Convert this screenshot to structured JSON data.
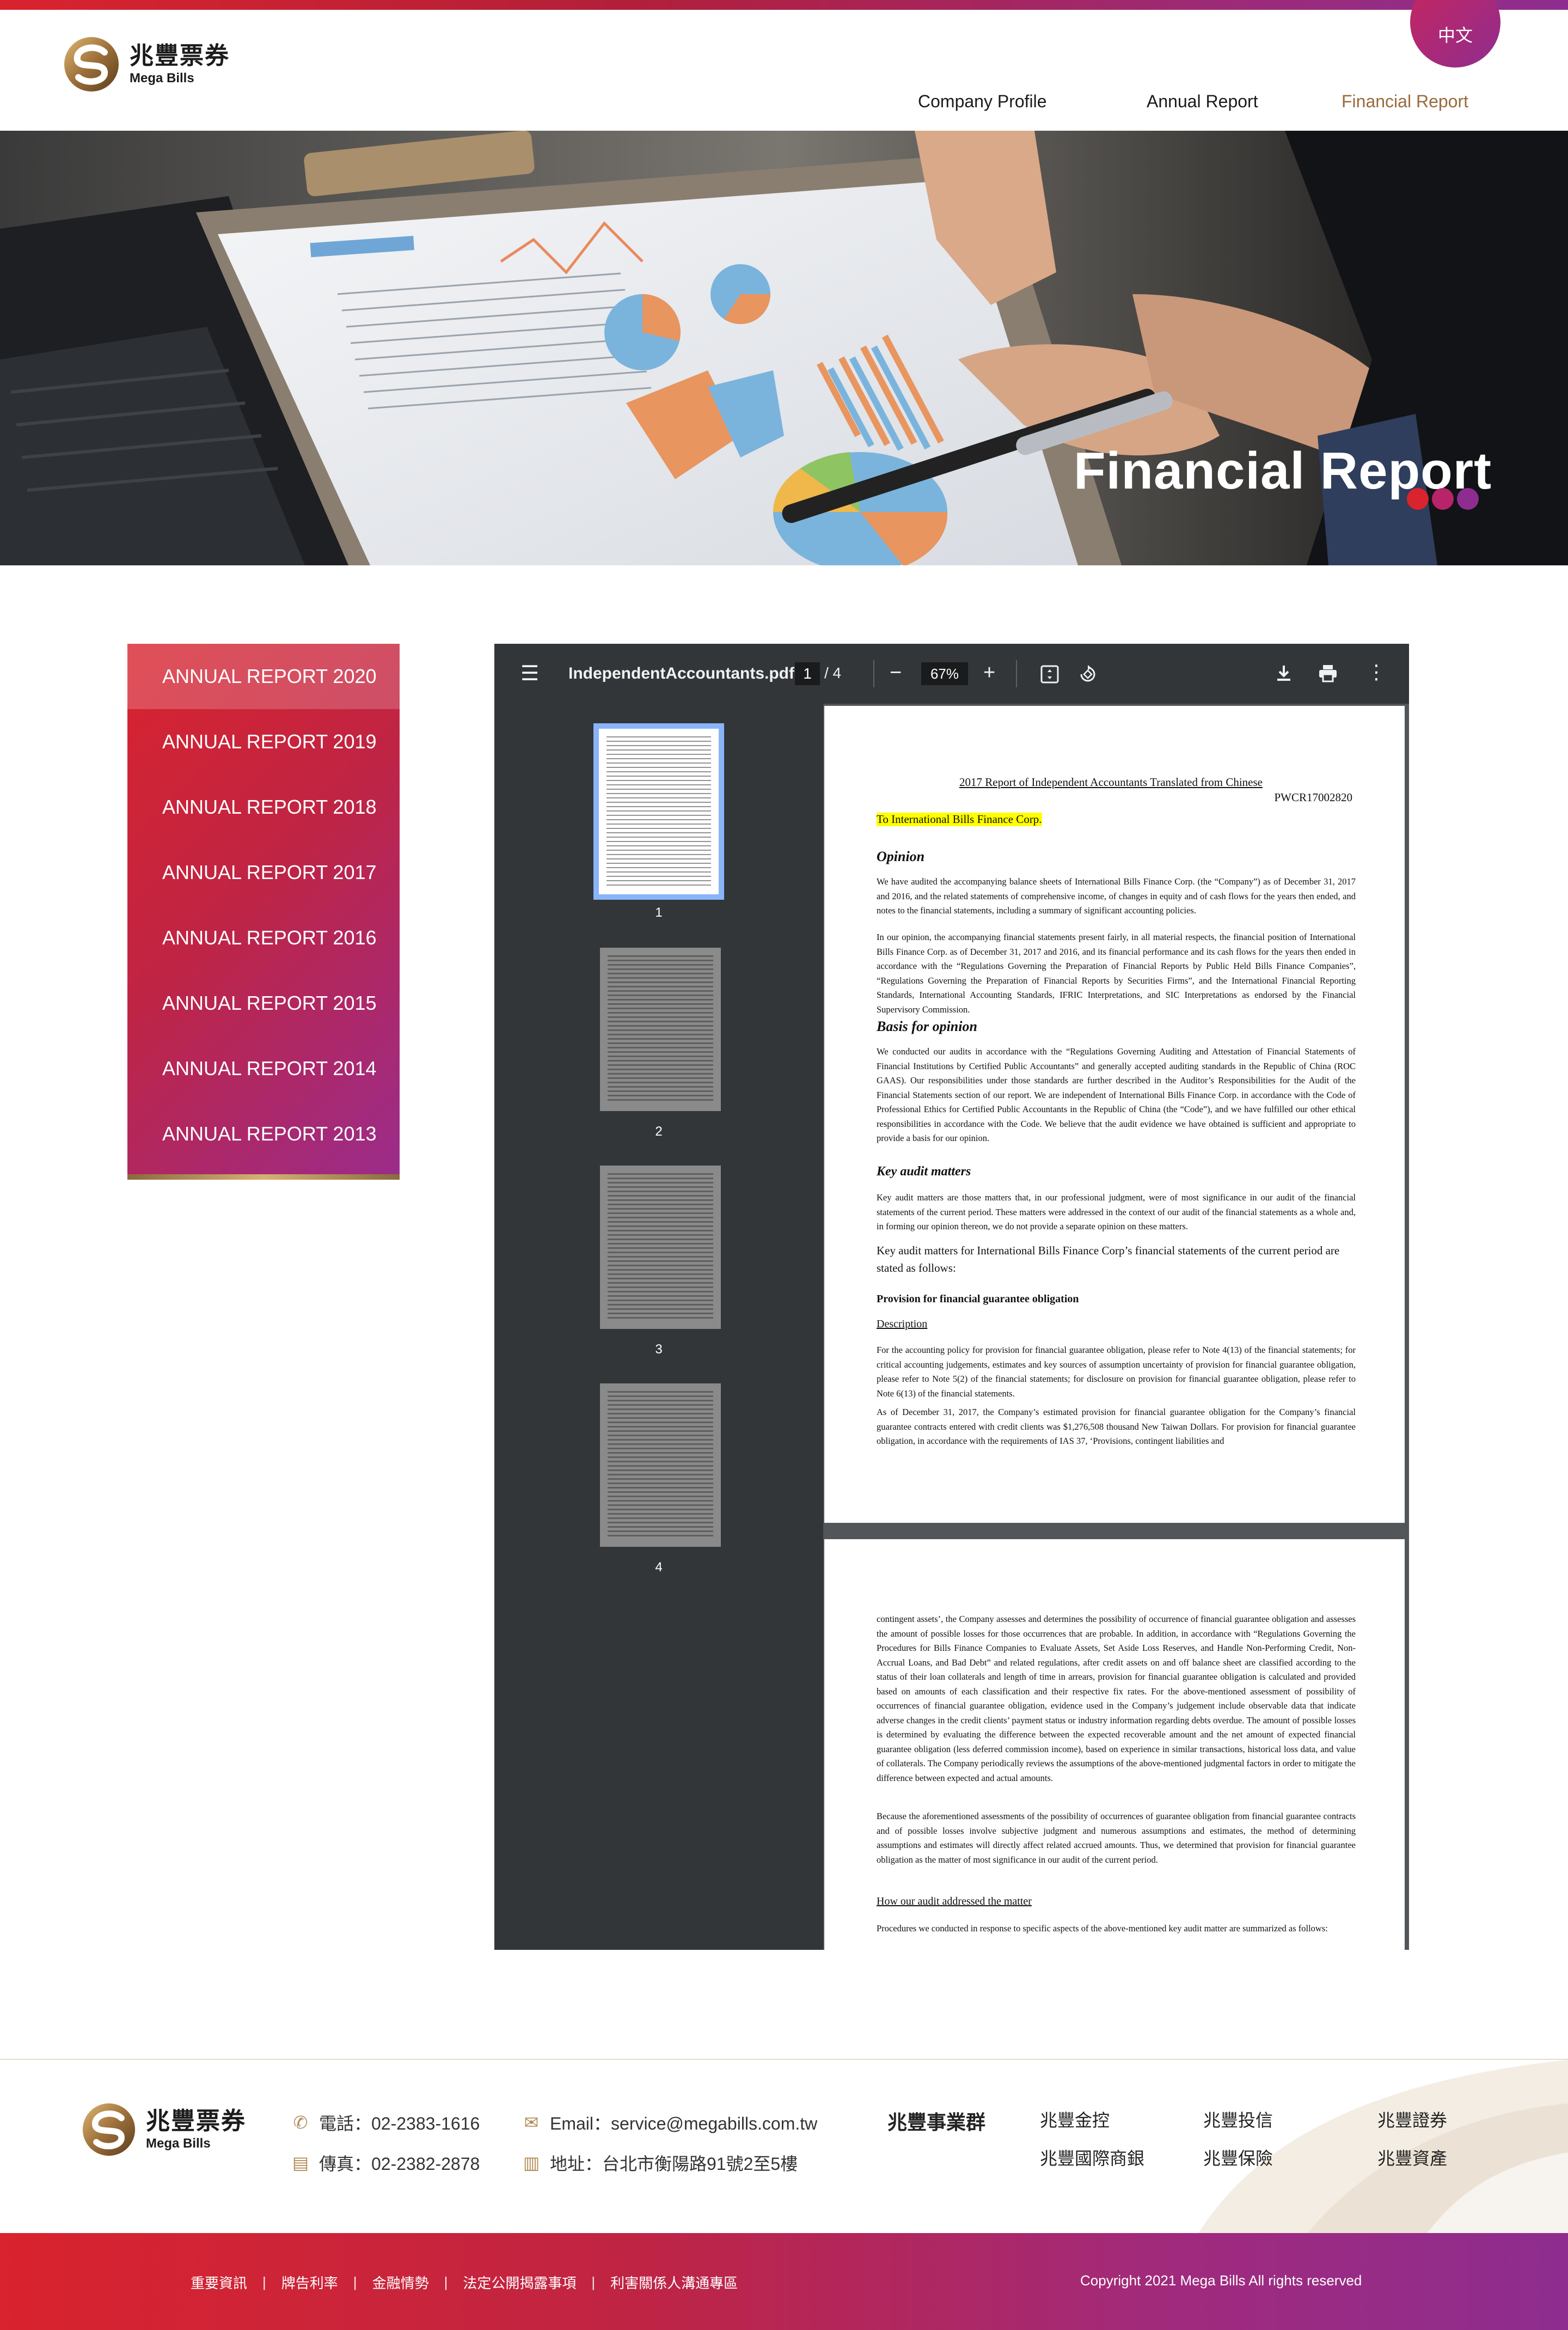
{
  "brand": {
    "name_cn": "兆豐票券",
    "name_en": "Mega Bills",
    "colors": {
      "red": "#d9232e",
      "purple": "#8e2d8f",
      "gold": "#9a6a3c"
    }
  },
  "header": {
    "lang_label": "中文",
    "nav": [
      {
        "label": "Company Profile",
        "active": false
      },
      {
        "label": "Annual Report",
        "active": false
      },
      {
        "label": "Financial Report",
        "active": true
      }
    ]
  },
  "banner": {
    "title": "Financial Report"
  },
  "sidebar": {
    "items": [
      {
        "label": "ANNUAL REPORT 2020",
        "active": true
      },
      {
        "label": "ANNUAL REPORT 2019",
        "active": false
      },
      {
        "label": "ANNUAL REPORT 2018",
        "active": false
      },
      {
        "label": "ANNUAL REPORT 2017",
        "active": false
      },
      {
        "label": "ANNUAL REPORT 2016",
        "active": false
      },
      {
        "label": "ANNUAL REPORT 2015",
        "active": false
      },
      {
        "label": "ANNUAL REPORT 2014",
        "active": false
      },
      {
        "label": "ANNUAL REPORT 2013",
        "active": false
      }
    ]
  },
  "viewer": {
    "file_name": "IndependentAccountants.pdf",
    "current_page": "1",
    "total_pages": "/ 4",
    "zoom": "67%",
    "thumb_labels": [
      "1",
      "2",
      "3",
      "4"
    ],
    "icons": [
      "menu-icon",
      "zoom-out-icon",
      "zoom-in-icon",
      "fit-page-icon",
      "rotate-icon",
      "download-icon",
      "print-icon",
      "more-icon"
    ]
  },
  "page1": {
    "title": "2017 Report of Independent Accountants Translated from Chinese",
    "code": "PWCR17002820",
    "to": "To International Bills Finance Corp.",
    "h_opinion": "Opinion",
    "p_opinion_1": "We have audited the accompanying balance sheets of International Bills Finance Corp. (the “Company”) as of December 31, 2017 and 2016, and the related statements of comprehensive income, of changes in equity and of cash flows for the years then ended, and notes to the financial statements, including a summary of significant accounting policies.",
    "p_opinion_2": "In our opinion, the accompanying financial statements present fairly, in all material respects, the financial position of International Bills Finance Corp. as of December 31, 2017 and 2016, and its financial performance and its cash flows for the years then ended in accordance with the “Regulations Governing the Preparation of Financial Reports by Public Held Bills Finance Companies”, “Regulations Governing the Preparation of Financial Reports by Securities Firms”, and the International Financial Reporting Standards, International Accounting Standards, IFRIC Interpretations, and SIC Interpretations as endorsed by the Financial Supervisory Commission.",
    "h_basis": "Basis for opinion",
    "p_basis": "We conducted our audits in accordance with the “Regulations Governing Auditing and Attestation of Financial Statements of Financial Institutions by Certified Public Accountants” and generally accepted auditing standards in the Republic of China (ROC GAAS). Our responsibilities under those standards are further described in the Auditor’s Responsibilities for the Audit of the Financial Statements section of our report. We are independent of International Bills Finance Corp. in accordance with the Code of Professional Ethics for Certified Public Accountants in the Republic of China (the “Code”), and we have fulfilled our other ethical responsibilities in accordance with the Code. We believe that the audit evidence we have obtained is sufficient and appropriate to provide a basis for our opinion.",
    "h_kam": "Key audit matters",
    "p_kam": "Key audit matters are those matters that, in our professional judgment, were of most significance in our audit of the financial statements of the current period. These matters were addressed in the context of our audit of the financial statements as a whole and, in forming our opinion thereon, we do not provide a separate opinion on these matters.",
    "p_kam_2": "Key audit matters for International Bills Finance Corp’s financial statements of the current period are stated as follows:",
    "h_provision": "Provision for financial guarantee obligation",
    "u_description": "Description",
    "p_desc_1": "For the accounting policy for provision for financial guarantee obligation, please refer to Note 4(13) of the financial statements; for critical accounting judgements, estimates and key sources of assumption uncertainty of provision for financial guarantee obligation, please refer to Note 5(2) of the financial statements; for disclosure on provision for financial guarantee obligation, please refer to Note 6(13) of the financial statements.",
    "p_desc_2": "As of December 31, 2017, the Company’s estimated provision for financial guarantee obligation for the Company’s financial guarantee contracts entered with credit clients was $1,276,508 thousand New Taiwan Dollars. For provision for financial guarantee obligation, in accordance with the requirements of IAS 37, ‘Provisions, contingent liabilities and"
  },
  "page2": {
    "p_1": "contingent assets’, the Company assesses and determines the possibility of occurrence of financial guarantee obligation and assesses the amount of possible losses for those occurrences that are probable. In addition, in accordance with “Regulations Governing the Procedures for Bills Finance Companies to Evaluate Assets, Set Aside Loss Reserves, and Handle Non-Performing Credit, Non-Accrual Loans, and Bad Debt” and related regulations, after credit assets on and off balance sheet are classified according to the status of their loan collaterals and length of time in arrears, provision for financial guarantee obligation is calculated and provided based on amounts of each classification and their respective fix rates. For the above-mentioned assessment of possibility of occurrences of financial guarantee obligation, evidence used in the Company’s judgement include observable data that indicate adverse changes in the credit clients’ payment status or industry information regarding debts overdue. The amount of possible losses is determined by evaluating the difference between the expected recoverable amount and the net amount of expected financial guarantee obligation (less deferred commission income), based on experience in similar transactions, historical loss data, and value of collaterals. The Company periodically reviews the assumptions of the above-mentioned judgmental factors in order to mitigate the difference between expected and actual amounts.",
    "p_2": "Because the aforementioned assessments of the possibility of occurrences of guarantee obligation from financial guarantee contracts and of possible losses involve subjective judgment and numerous assumptions and estimates, the method of determining assumptions and estimates will directly affect related accrued amounts. Thus, we determined that provision for financial guarantee obligation as the matter of most significance in our audit of the current period.",
    "u_how": "How our audit addressed the matter",
    "p_3": "Procedures we conducted in response to specific aspects of the above-mentioned key audit matter are summarized as follows:"
  },
  "footer": {
    "phone": "電話：02-2383-1616",
    "fax": "傳真：02-2382-2878",
    "email": "Email：service@megabills.com.tw",
    "address": "地址：台北市衡陽路91號2至5樓",
    "group_title": "兆豐事業群",
    "group_links": [
      "兆豐金控",
      "兆豐投信",
      "兆豐證券",
      "兆豐國際商銀",
      "兆豐保險",
      "兆豐資產"
    ],
    "bottom_links": [
      "重要資訊",
      "牌告利率",
      "金融情勢",
      "法定公開揭露事項",
      "利害關係人溝通專區"
    ],
    "copyright": "Copyright 2021 Mega Bills All rights reserved"
  }
}
